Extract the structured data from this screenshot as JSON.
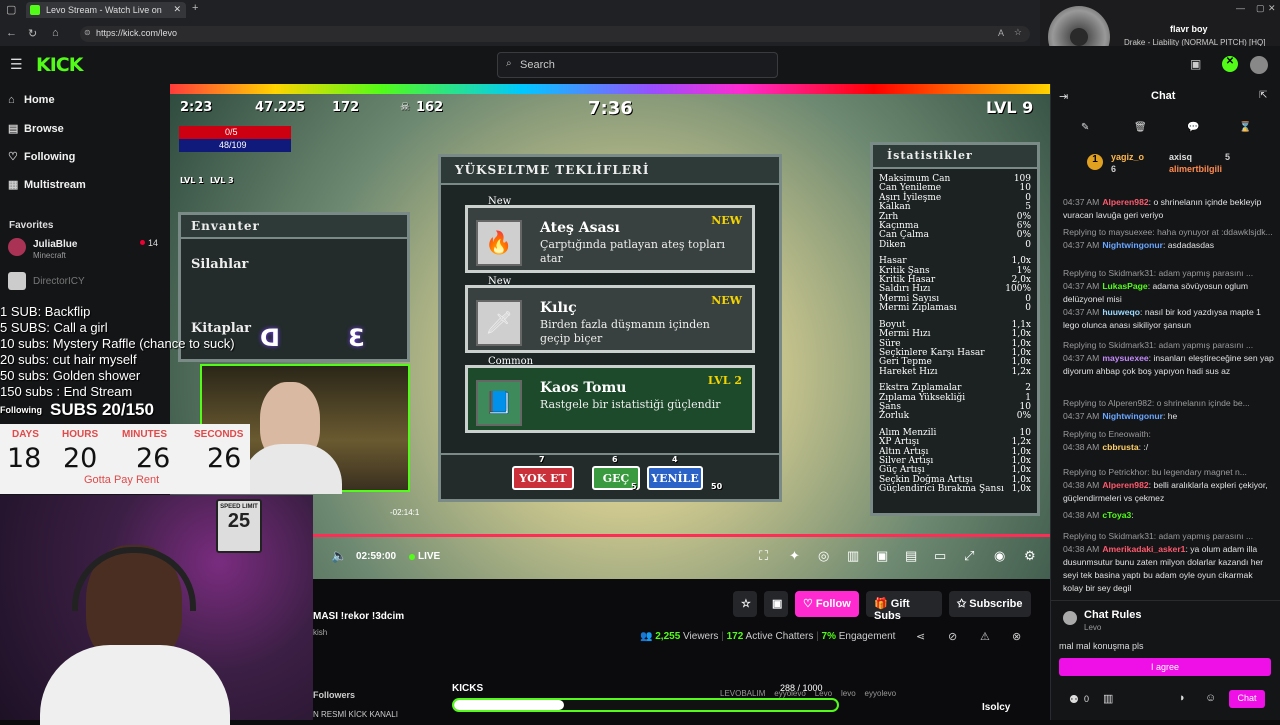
{
  "browser": {
    "tab_title": "Levo Stream - Watch Live on",
    "url": "https://kick.com/levo"
  },
  "media": {
    "title": "flavr boy",
    "subtitle": "Drake - Liability (NORMAL PITCH) [HQ]"
  },
  "header": {
    "logo": "KICK",
    "search_placeholder": "Search"
  },
  "sidebar": {
    "nav": [
      "Home",
      "Browse",
      "Following",
      "Multistream"
    ],
    "favorites_label": "Favorites",
    "favorites": [
      {
        "name": "JuliaBlue",
        "category": "Minecraft",
        "viewers": "14"
      },
      {
        "name": "DirectorICY",
        "category": "",
        "viewers": ""
      }
    ]
  },
  "game": {
    "hud_time": "2:23",
    "hud_gold": "47.225",
    "hud_gems": "172",
    "hud_kills": "162",
    "timer": "7:36",
    "level": "LVL 9",
    "hp": "0/5",
    "xp": "48/109",
    "lvl1": "LVL 1",
    "lvl3": "LVL 3",
    "inventory_title": "Envanter",
    "weapons_label": "Silahlar",
    "books_label": "Kitaplar",
    "upgrade_title": "YÜKSELTME TEKLİFLERİ",
    "offers": [
      {
        "rarity": "New",
        "title": "Ateş Asası",
        "desc": "Çarptığında patlayan ateş topları atar",
        "tag": "NEW",
        "icon": "🔥"
      },
      {
        "rarity": "New",
        "title": "Kılıç",
        "desc": "Birden fazla düşmanın içinden geçip biçer",
        "tag": "NEW",
        "icon": "🗡"
      },
      {
        "rarity": "Common",
        "title": "Kaos Tomu",
        "desc": "Rastgele bir istatistiği güçlendir",
        "tag": "LVL 2",
        "icon": "📘"
      }
    ],
    "buttons": [
      {
        "label": "YOK ET",
        "count": "7"
      },
      {
        "label": "GEÇ",
        "count": "6"
      },
      {
        "label": "YENİLE",
        "count": "4"
      }
    ],
    "costs": [
      "5",
      "50"
    ],
    "stats_title": "İstatistikler",
    "stats_group1": [
      [
        "Maksimum Can",
        "109"
      ],
      [
        "Can Yenileme",
        "10"
      ],
      [
        "Aşırı İyileşme",
        "0"
      ],
      [
        "Kalkan",
        "5"
      ],
      [
        "Zırh",
        "0%"
      ],
      [
        "Kaçınma",
        "6%"
      ],
      [
        "Can Çalma",
        "0%"
      ],
      [
        "Diken",
        "0"
      ]
    ],
    "stats_group2": [
      [
        "Hasar",
        "1,0x"
      ],
      [
        "Kritik Şans",
        "1%"
      ],
      [
        "Kritik Hasar",
        "2,0x"
      ],
      [
        "Saldırı Hızı",
        "100%"
      ],
      [
        "Mermi Sayısı",
        "0"
      ],
      [
        "Mermi Zıplaması",
        "0"
      ]
    ],
    "stats_group3": [
      [
        "Boyut",
        "1,1x"
      ],
      [
        "Mermi Hızı",
        "1,0x"
      ],
      [
        "Süre",
        "1,0x"
      ],
      [
        "Seçkinlere Karşı Hasar",
        "1,0x"
      ],
      [
        "Geri Tepme",
        "1,0x"
      ],
      [
        "Hareket Hızı",
        "1,2x"
      ]
    ],
    "stats_group4": [
      [
        "Ekstra Zıplamalar",
        "2"
      ],
      [
        "Zıplama Yüksekliği",
        "1"
      ],
      [
        "Şans",
        "10"
      ],
      [
        "Zorluk",
        "0%"
      ]
    ],
    "stats_group5": [
      [
        "Alım Menzili",
        "10"
      ],
      [
        "XP Artışı",
        "1,2x"
      ],
      [
        "Altın Artışı",
        "1,0x"
      ],
      [
        "Silver Artışı",
        "1,0x"
      ],
      [
        "Güç Artışı",
        "1,0x"
      ],
      [
        "Seçkin Doğma Artışı",
        "1,0x"
      ],
      [
        "Güçlendirici Bırakma Şansı",
        "1,0x"
      ]
    ]
  },
  "overlay": {
    "sub_goals": [
      "1 SUB: Backflip",
      "5 SUBS: Call a girl",
      "10 subs: Mystery Raffle (chance to suck)",
      "20 subs: cut hair myself",
      "50 subs: Golden shower",
      "150 subs : End Stream"
    ],
    "following": "Following",
    "subs_counter": "SUBS 20/150",
    "countdown_labels": [
      "DAYS",
      "HOURS",
      "MINUTES",
      "SECONDS"
    ],
    "countdown_values": [
      "18",
      "20",
      "26",
      "26"
    ],
    "countdown_caption": "Gotta Pay Rent",
    "speed_sign_top": "SPEED LIMIT",
    "speed_sign_num": "25",
    "cam_overlay_text": "ᗡ  Ɛ"
  },
  "player": {
    "time": "02:59:00",
    "live": "LIVE",
    "scrub_time": "-02:14:1"
  },
  "stream_info": {
    "title": "MASI !rekor !3dcim",
    "category": "kish",
    "viewers": "2,255",
    "viewers_label": "Viewers",
    "chatters": "172",
    "chatters_label": "Active Chatters",
    "engagement": "7%",
    "engagement_label": "Engagement",
    "follow": "Follow",
    "gift_subs": "Gift Subs",
    "subscribe": "Subscribe",
    "followers_label": "Followers",
    "kicks_label": "KICKS",
    "kicks_progress": "288 / 1000",
    "kicks_fraction": 0.288,
    "bottom_banner": "N RESMİ KİCK KANALI",
    "socials": [
      "LEVOBALIM",
      "eyyolevo",
      "Levo",
      "levo",
      "eyyolevo"
    ],
    "isolcy": "Isolcy"
  },
  "chat": {
    "title": "Chat",
    "top_users": [
      {
        "name": "yagiz_o",
        "count": "6"
      },
      {
        "name": "axisq",
        "count": "5"
      },
      {
        "name": "alimertbilgili",
        "count": ""
      }
    ],
    "messages": [
      {
        "time": "04:37 AM",
        "user": "Alperen982",
        "color": "#ff5a6e",
        "text": "o shrinelanın içinde bekleyip vuracan lavuğa geri veriyo",
        "reply": ""
      },
      {
        "time": "04:37 AM",
        "user": "Nightwingonur",
        "color": "#6aa7ff",
        "text": "asdadasdas",
        "reply": "Replying to maysuexee: haha oynuyor at :ddawklsjdk..."
      },
      {
        "time": "04:37 AM",
        "user": "LukasPage",
        "color": "#53fc18",
        "text": "adama sövüyosun oglum delüzyonel misi",
        "reply": "Replying to Skidmark31: adam yapmış parasını ..."
      },
      {
        "time": "04:37 AM",
        "user": "huuweqo",
        "color": "#9ad8ff",
        "text": "nasıl bir kod yazdıysa mapte 1 lego olunca anası sikiliyor şansun",
        "reply": ""
      },
      {
        "time": "04:37 AM",
        "user": "maysuexee",
        "color": "#c58bff",
        "text": "insanları eleştireceğine sen yap diyorum ahbap çok boş yapıyon hadi sus az",
        "reply": "Replying to Skidmark31: adam yapmış parasını ..."
      },
      {
        "time": "04:37 AM",
        "user": "Nightwingonur",
        "color": "#6aa7ff",
        "text": "he",
        "reply": "Replying to Alperen982: o shrinelanın içinde be..."
      },
      {
        "time": "04:38 AM",
        "user": "cbbrusta",
        "color": "#ffd166",
        "text": ":/",
        "reply": "Replying to Eneowaith:"
      },
      {
        "time": "04:38 AM",
        "user": "Alperen982",
        "color": "#ff5a6e",
        "text": "belli aralıklarla expleri çekiyor, güçlendirmeleri vs çekmez",
        "reply": "Replying to Petrickhor: bu legendary magnet n..."
      },
      {
        "time": "04:38 AM",
        "user": "cToya3",
        "color": "#53fc18",
        "text": "",
        "reply": ""
      },
      {
        "time": "04:38 AM",
        "user": "Amerikadaki_asker1",
        "color": "#ff5a6e",
        "text": "ya olum adam illa dusunmsutur bunu zaten milyon dolarlar kazandı her seyi tek basina yaptı bu adam oyle oyun cikarmak kolay bir sey degil",
        "reply": "Replying to Skidmark31: adam yapmış parasını ..."
      }
    ],
    "rules_title": "Chat Rules",
    "rules_user": "Levo",
    "rules_text": "mal mal konuşma pls",
    "agree": "I agree",
    "bottom_count": "0",
    "chat_button": "Chat"
  },
  "colors": {
    "kick_green": "#53fc18",
    "follow_pink": "#ff2bd0",
    "agree_pink": "#ee10e6"
  }
}
